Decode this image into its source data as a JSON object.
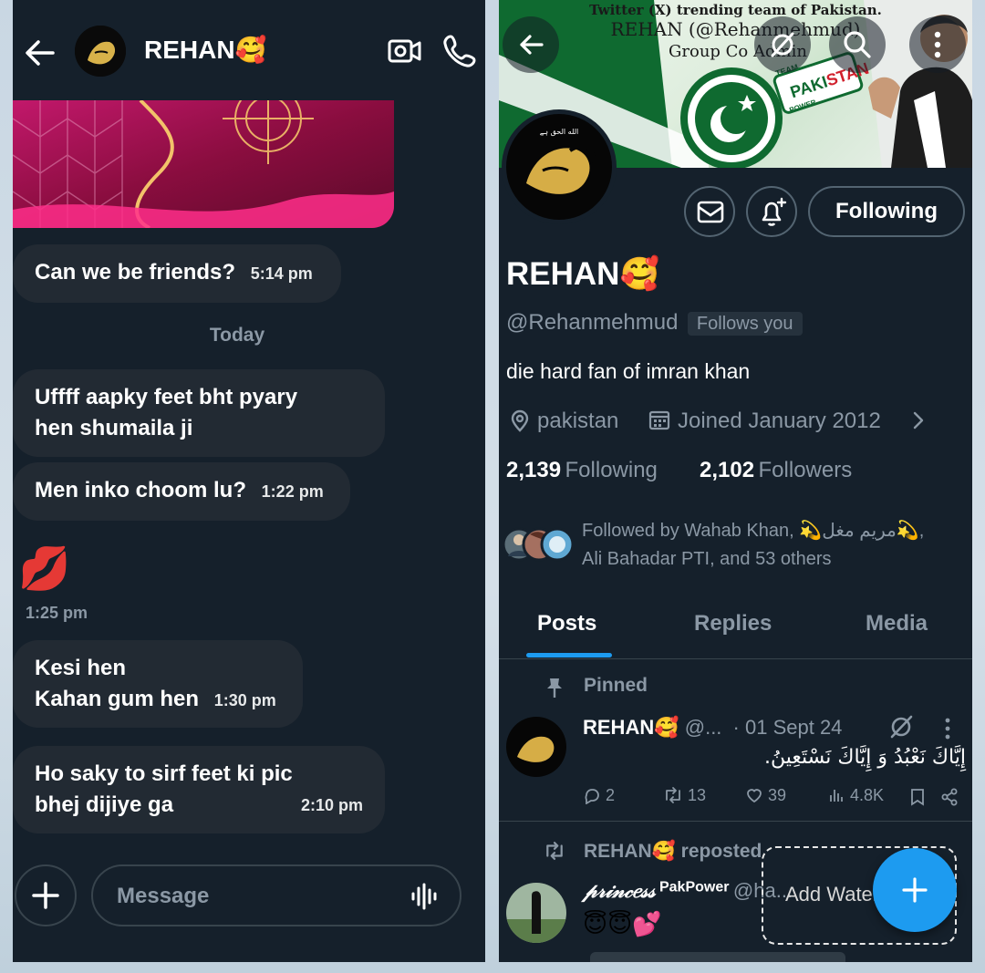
{
  "dm": {
    "title": "REHAN🥰",
    "messages": [
      {
        "text": "Can we be friends?",
        "time": "5:14 pm"
      },
      {
        "text": "Uffff aapky feet bht pyary hen shumaila ji",
        "line1": "Uffff aapky feet bht pyary",
        "line2": "hen shumaila ji"
      },
      {
        "text": "Men inko choom lu?",
        "time": "1:22 pm"
      },
      {
        "text": "💋",
        "time": "1:25 pm"
      },
      {
        "line1": "Kesi hen",
        "line2": "Kahan gum hen",
        "time": "1:30 pm"
      },
      {
        "line1": "Ho saky to  sirf feet ki pic",
        "line2": "bhej dijiye ga",
        "time": "2:10 pm"
      }
    ],
    "day_separator": "Today",
    "composer_placeholder": "Message",
    "icons": [
      "back-arrow-icon",
      "video-call-icon",
      "phone-icon",
      "plus-icon",
      "voice-wave-icon"
    ]
  },
  "profile": {
    "banner_text": {
      "line1": "Twitter (X) trending team of  Pakistan.",
      "line2": "REHAN (@Rehanmehmud)",
      "line3": "Group Co Admin",
      "team": "TEAM",
      "paki": "PAKI",
      "stan": "STAN",
      "power": "POWER"
    },
    "following_button": "Following",
    "name": "REHAN🥰",
    "handle": "@Rehanmehmud",
    "follows_you": "Follows you",
    "bio": "die hard fan of imran khan",
    "location": "pakistan",
    "joined": "Joined January 2012",
    "following_count": "2,139",
    "following_label": "Following",
    "followers_count": "2,102",
    "followers_label": "Followers",
    "followed_by_line1": "Followed by Wahab Khan, 💫مریم مغل💫,",
    "followed_by_line2": "Ali Bahadar PTI, and 53 others",
    "tabs": [
      {
        "label": "Posts",
        "active": true
      },
      {
        "label": "Replies",
        "active": false
      },
      {
        "label": "Media",
        "active": false
      }
    ],
    "pinned_label": "Pinned",
    "pinned_tweet": {
      "name": "REHAN🥰",
      "handle": "@...",
      "date": "· 01 Sept 24",
      "text": "إِيَّاكَ نَعْبُدُ وَ إِيَّاكَ نَسْتَعِينُ.",
      "replies": "2",
      "retweets": "13",
      "likes": "39",
      "views": "4.8K"
    },
    "repost_label": "REHAN🥰 reposted",
    "repost_tweet": {
      "name": "𝓅𝓇𝒾𝓃𝒸𝑒𝓈𝓈",
      "badge": "PakPower",
      "handle": "@ha...",
      "emojis": "😇😇💕"
    },
    "watermark": "Add Watermark",
    "accent_color": "#1d9bf0",
    "banner_colors": {
      "green": "#01411c",
      "red": "#d1202c"
    }
  }
}
